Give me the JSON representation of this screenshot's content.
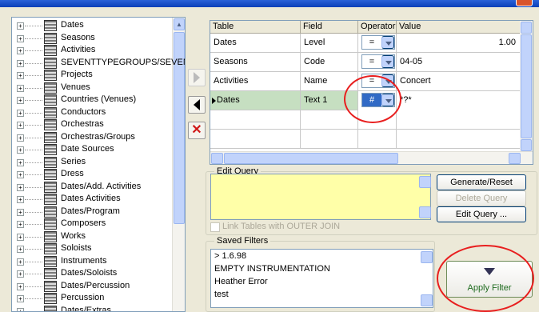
{
  "tree": {
    "items": [
      "Dates",
      "Seasons",
      "Activities",
      "SEVENTTYPEGROUPS/SEVEN",
      "Projects",
      "Venues",
      "Countries (Venues)",
      "Conductors",
      "Orchestras",
      "Orchestras/Groups",
      "Date Sources",
      "Series",
      "Dress",
      "Dates/Add. Activities",
      "Dates Activities",
      "Dates/Program",
      "Composers",
      "Works",
      "Soloists",
      "Instruments",
      "Dates/Soloists",
      "Dates/Percussion",
      "Percussion",
      "Dates/Extras"
    ]
  },
  "grid": {
    "headers": {
      "table": "Table",
      "field": "Field",
      "operator": "Operator",
      "value": "Value"
    },
    "rows": [
      {
        "table": "Dates",
        "field": "Level",
        "operator": "=",
        "value": "1.00"
      },
      {
        "table": "Seasons",
        "field": "Code",
        "operator": "=",
        "value": "04-05"
      },
      {
        "table": "Activities",
        "field": "Name",
        "operator": "=",
        "value": "Concert"
      },
      {
        "table": "Dates",
        "field": "Text 1",
        "operator": "#",
        "value": "*?*"
      }
    ]
  },
  "edit_query": {
    "label": "Edit Query",
    "generate_reset": "Generate/Reset Query",
    "delete": "Delete Query",
    "edit": "Edit Query ...",
    "outer_join": "Link Tables with OUTER JOIN"
  },
  "saved_filters": {
    "label": "Saved Filters",
    "items": [
      "> 1.6.98",
      "EMPTY INSTRUMENTATION",
      "Heather Error",
      "test"
    ]
  },
  "apply": {
    "label": "Apply Filter"
  },
  "colors": {
    "accent": "#316ac5",
    "selected_row": "#c6dfc1",
    "query_bg": "#ffffa8",
    "annotation": "#e81f1f"
  }
}
